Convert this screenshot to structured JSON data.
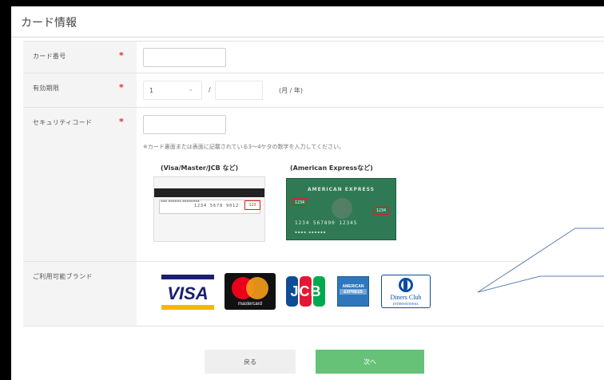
{
  "page": {
    "title": "カード情報"
  },
  "form": {
    "card_number": {
      "label": "カード番号",
      "required_mark": "*",
      "value": ""
    },
    "expiry": {
      "label": "有効期限",
      "required_mark": "*",
      "month": "1",
      "separator": "/",
      "year": "",
      "unit": "(月 / 年)"
    },
    "security_code": {
      "label": "セキュリティコード",
      "required_mark": "*",
      "value": "",
      "note": "※カード裏面または表面に記載されている3〜4ケタの数字を入力してください。",
      "example1_caption": "(Visa/Master/JCB など)",
      "example2_caption": "(American Expressなど)",
      "example1_digits": "1234 5678 9012",
      "example1_cvv": "123",
      "example2_brand": "AMERICAN EXPRESS",
      "example2_cid_front": "1234",
      "example2_cid_side": "1234",
      "example2_number": "1234 567890 12345"
    },
    "brands": {
      "label": "ご利用可能ブランド",
      "items": [
        "VISA",
        "mastercard",
        "JCB",
        "AMERICAN EXPRESS",
        "Diners Club",
        "INTERNATIONAL"
      ]
    }
  },
  "buttons": {
    "back": "戻る",
    "next": "次へ"
  },
  "colors": {
    "required": "#e0312f",
    "next_button": "#66c277",
    "back_button": "#efefef"
  }
}
